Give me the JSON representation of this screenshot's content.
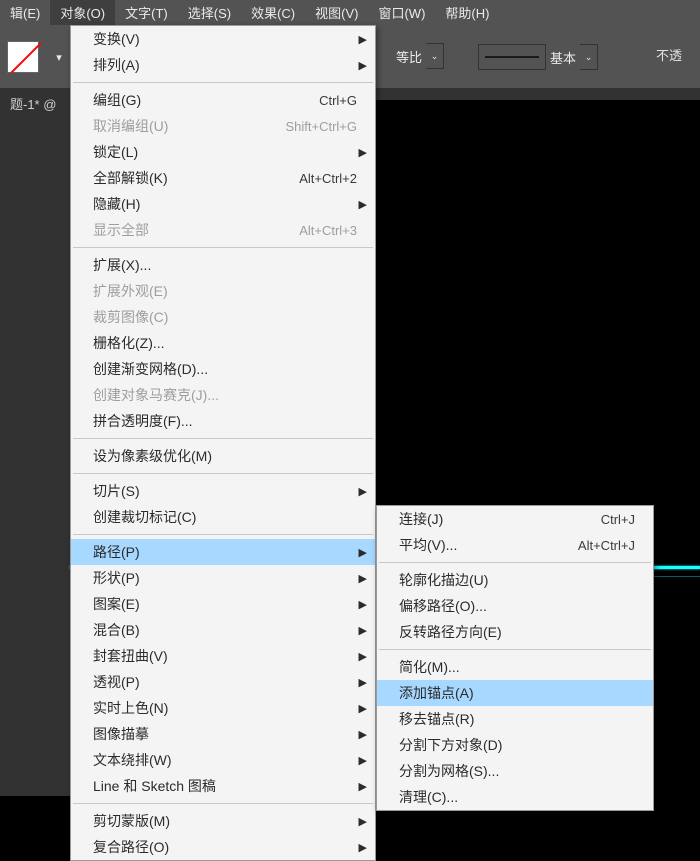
{
  "menubar": {
    "items": [
      {
        "label": "辑(E)"
      },
      {
        "label": "对象(O)"
      },
      {
        "label": "文字(T)"
      },
      {
        "label": "选择(S)"
      },
      {
        "label": "效果(C)"
      },
      {
        "label": "视图(V)"
      },
      {
        "label": "窗口(W)"
      },
      {
        "label": "帮助(H)"
      }
    ],
    "active_index": 1
  },
  "toolbar": {
    "ratio_label": "等比",
    "profile_label": "基本",
    "opacity_label": "不透"
  },
  "document": {
    "tab_label": "题-1* @"
  },
  "menu_object": {
    "items": [
      {
        "label": "变换(V)",
        "submenu": true
      },
      {
        "label": "排列(A)",
        "submenu": true
      },
      {
        "sep": true
      },
      {
        "label": "编组(G)",
        "shortcut": "Ctrl+G"
      },
      {
        "label": "取消编组(U)",
        "shortcut": "Shift+Ctrl+G",
        "disabled": true
      },
      {
        "label": "锁定(L)",
        "submenu": true
      },
      {
        "label": "全部解锁(K)",
        "shortcut": "Alt+Ctrl+2"
      },
      {
        "label": "隐藏(H)",
        "submenu": true
      },
      {
        "label": "显示全部",
        "shortcut": "Alt+Ctrl+3",
        "disabled": true
      },
      {
        "sep": true
      },
      {
        "label": "扩展(X)..."
      },
      {
        "label": "扩展外观(E)",
        "disabled": true
      },
      {
        "label": "裁剪图像(C)",
        "disabled": true
      },
      {
        "label": "栅格化(Z)..."
      },
      {
        "label": "创建渐变网格(D)..."
      },
      {
        "label": "创建对象马赛克(J)...",
        "disabled": true
      },
      {
        "label": "拼合透明度(F)..."
      },
      {
        "sep": true
      },
      {
        "label": "设为像素级优化(M)"
      },
      {
        "sep": true
      },
      {
        "label": "切片(S)",
        "submenu": true
      },
      {
        "label": "创建裁切标记(C)"
      },
      {
        "sep": true
      },
      {
        "label": "路径(P)",
        "submenu": true,
        "highlight": true
      },
      {
        "label": "形状(P)",
        "submenu": true
      },
      {
        "label": "图案(E)",
        "submenu": true
      },
      {
        "label": "混合(B)",
        "submenu": true
      },
      {
        "label": "封套扭曲(V)",
        "submenu": true
      },
      {
        "label": "透视(P)",
        "submenu": true
      },
      {
        "label": "实时上色(N)",
        "submenu": true
      },
      {
        "label": "图像描摹",
        "submenu": true
      },
      {
        "label": "文本绕排(W)",
        "submenu": true
      },
      {
        "label": "Line 和 Sketch 图稿",
        "submenu": true
      },
      {
        "sep": true
      },
      {
        "label": "剪切蒙版(M)",
        "submenu": true
      },
      {
        "label": "复合路径(O)",
        "submenu": true
      }
    ]
  },
  "menu_path": {
    "items": [
      {
        "label": "连接(J)",
        "shortcut": "Ctrl+J"
      },
      {
        "label": "平均(V)...",
        "shortcut": "Alt+Ctrl+J"
      },
      {
        "sep": true
      },
      {
        "label": "轮廓化描边(U)"
      },
      {
        "label": "偏移路径(O)..."
      },
      {
        "label": "反转路径方向(E)"
      },
      {
        "sep": true
      },
      {
        "label": "简化(M)..."
      },
      {
        "label": "添加锚点(A)",
        "highlight": true
      },
      {
        "label": "移去锚点(R)"
      },
      {
        "label": "分割下方对象(D)"
      },
      {
        "label": "分割为网格(S)..."
      },
      {
        "label": "清理(C)..."
      }
    ]
  }
}
